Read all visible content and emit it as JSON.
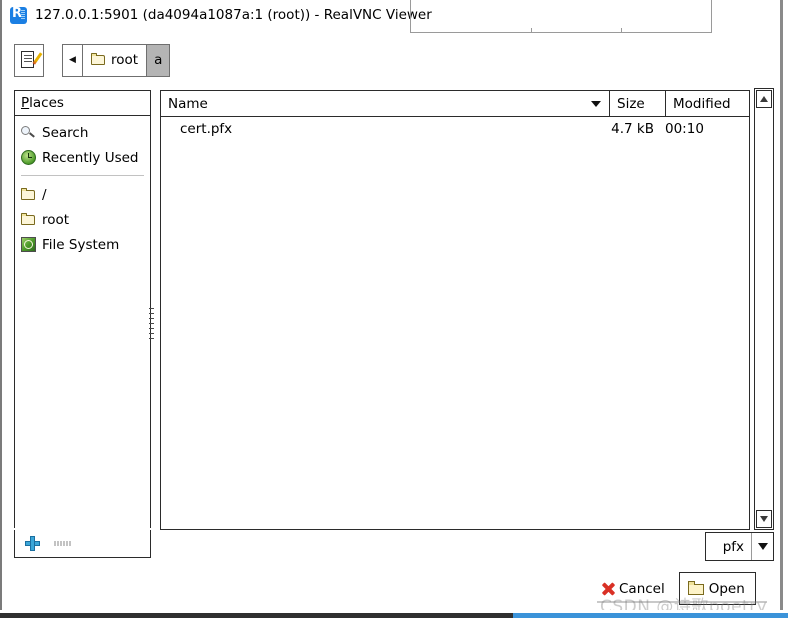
{
  "window": {
    "title": "127.0.0.1:5901 (da4094a1087a:1 (root)) - RealVNC Viewer",
    "logo_icon": "realvnc-logo-icon"
  },
  "toolbar": {
    "create_folder_icon": "edit-document-icon",
    "back_icon": "back-arrow-icon",
    "breadcrumbs": [
      {
        "label": "root",
        "icon": "folder-icon",
        "active": false
      },
      {
        "label": "a",
        "icon": "",
        "active": true
      }
    ]
  },
  "sidebar": {
    "header": "Places",
    "header_mnemonic": "P",
    "items": [
      {
        "label": "Search",
        "icon": "search-icon"
      },
      {
        "label": "Recently Used",
        "icon": "recent-clock-icon"
      },
      {
        "label": "/",
        "icon": "folder-icon"
      },
      {
        "label": "root",
        "icon": "folder-icon"
      },
      {
        "label": "File System",
        "icon": "drive-icon"
      }
    ],
    "add_icon": "plus-icon",
    "remove_icon": "minus-icon"
  },
  "file_list": {
    "columns": [
      "Name",
      "Size",
      "Modified"
    ],
    "sort_icon": "sort-descending-arrow-icon",
    "rows": [
      {
        "name": "cert.pfx",
        "size": "4.7 kB",
        "modified": "00:10"
      }
    ]
  },
  "scrollbar": {
    "up_icon": "scroll-up-arrow-icon",
    "down_icon": "scroll-down-arrow-icon"
  },
  "filter": {
    "value": "pfx",
    "chevron_icon": "chevron-down-icon"
  },
  "actions": {
    "cancel_label": "Cancel",
    "cancel_icon": "close-x-icon",
    "open_label": "Open",
    "open_icon": "open-folder-icon"
  },
  "watermark": {
    "text": "CSDN @诗歌poetry"
  }
}
